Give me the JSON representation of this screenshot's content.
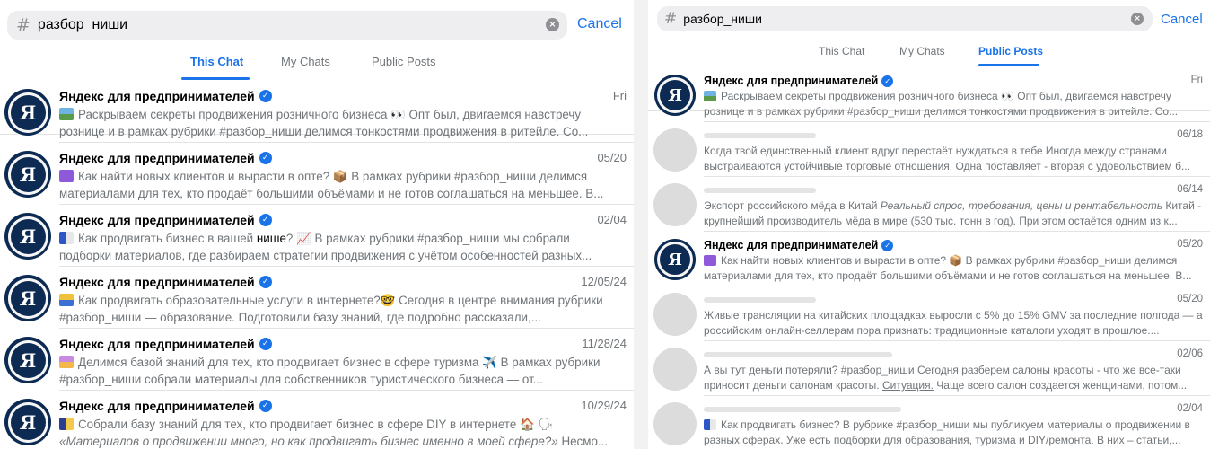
{
  "colors": {
    "accent": "#1a73e8",
    "secondary_text": "#707579",
    "search_bg": "#eeeef0",
    "avatar_navy": "#0c2a52",
    "placeholder": "#dcdcdc"
  },
  "left": {
    "search": {
      "hash": "#",
      "query": "разбор_ниши",
      "clear_icon": "×",
      "cancel": "Cancel"
    },
    "tabs": [
      {
        "label": "This Chat",
        "active": true
      },
      {
        "label": "My Chats",
        "active": false
      },
      {
        "label": "Public Posts",
        "active": false
      }
    ],
    "results": [
      {
        "avatar_letter": "Я",
        "channel": "Яндекс для предпринимателей",
        "date": "Fri",
        "emoji": "picture-icon",
        "text": "Раскрываем секреты продвижения розничного бизнеса 👀 Опт был, двигаемся навстречу рознице и в рамках рубрики #разбор_ниши делимся тонкостями продвижения в ритейле.   Со..."
      },
      {
        "avatar_letter": "Я",
        "channel": "Яндекс для предпринимателей",
        "date": "05/20",
        "emoji": "chart-icon",
        "text": "Как найти новых клиентов и вырасти в опте? 📦 В рамках рубрики #разбор_ниши делимся материалами для тех, кто продаёт большими объёмами и не готов соглашаться на меньшее. В..."
      },
      {
        "avatar_letter": "Я",
        "channel": "Яндекс для предпринимателей",
        "date": "02/04",
        "emoji": "flag-icon",
        "text_a": "Как продвигать бизнес в вашей ",
        "text_hl": "нише",
        "text_b": "? 📈 В рамках рубрики #разбор_ниши мы собрали подборки материалов, где разбираем стратегии продвижения с учётом особенностей разных..."
      },
      {
        "avatar_letter": "Я",
        "channel": "Яндекс для предпринимателей",
        "date": "12/05/24",
        "emoji": "book-icon",
        "text": "Как продвигать образовательные услуги в интернете?🤓 Сегодня в центре внимания рубрики #разбор_ниши — образование. Подготовили базу знаний, где подробно рассказали,..."
      },
      {
        "avatar_letter": "Я",
        "channel": "Яндекс для предпринимателей",
        "date": "11/28/24",
        "emoji": "photo-icon",
        "text": "Делимся базой знаний для тех, кто продвигает бизнес в сфере туризма ✈️ В рамках рубрики #разбор_ниши собрали материалы для собственников туристического бизнеса — от..."
      },
      {
        "avatar_letter": "Я",
        "channel": "Яндекс для предпринимателей",
        "date": "10/29/24",
        "emoji": "tools-icon",
        "text_a": "Собрали базу знаний для тех, кто продвигает бизнес в сфере DIY в интернете 🏠 🗣",
        "text_i": "«Материалов о продвижении много, но как продвигать бизнес именно в моей сфере?»",
        "text_b": " Несмо..."
      }
    ]
  },
  "right": {
    "search": {
      "hash": "#",
      "query": "разбор_ниши",
      "clear_icon": "×",
      "cancel": "Cancel"
    },
    "tabs": [
      {
        "label": "This Chat",
        "active": false
      },
      {
        "label": "My Chats",
        "active": false
      },
      {
        "label": "Public Posts",
        "active": true
      }
    ],
    "results": [
      {
        "kind": "channel",
        "avatar_letter": "Я",
        "channel": "Яндекс для предпринимателей",
        "date": "Fri",
        "emoji": "picture-icon",
        "text": "Раскрываем секреты продвижения розничного бизнеса 👀 Опт был, двигаемся навстречу рознице и в рамках рубрики #разбор_ниши делимся тонкостями продвижения в ритейле.   Со..."
      },
      {
        "kind": "hidden",
        "date": "06/18",
        "text": "Когда твой единственный клиент вдруг перестаёт нуждаться в тебе Иногда между странами выстраиваются устойчивые торговые отношения. Одна поставляет - вторая с удовольствием б..."
      },
      {
        "kind": "hidden",
        "date": "06/14",
        "text_a": "Экспорт российского мёда в Китай ",
        "text_i": "Реальный спрос, требования, цены и рентабельность",
        "text_b": " Китай - крупнейший производитель мёда в мире (530 тыс. тонн в год). При этом остаётся одним из к..."
      },
      {
        "kind": "channel",
        "avatar_letter": "Я",
        "channel": "Яндекс для предпринимателей",
        "date": "05/20",
        "emoji": "chart-icon",
        "text": "Как найти новых клиентов и вырасти в опте? 📦 В рамках рубрики #разбор_ниши делимся материалами для тех, кто продаёт большими объёмами и не готов соглашаться на меньшее. В..."
      },
      {
        "kind": "hidden",
        "date": "05/20",
        "text": "Живые трансляции на китайских площадках выросли с 5% до 15% GMV за последние полгода — а российским онлайн-селлерам пора признать: традиционные каталоги уходят в прошлое...."
      },
      {
        "kind": "hidden",
        "date": "02/06",
        "text_a": "А вы тут деньги потеряли? #разбор_ниши Сегодня разберем салоны красоты - что же все-таки приносит деньги салонам красоты. ",
        "text_u": "Ситуация.",
        "text_b": " Чаще всего салон создается женщинами, потом..."
      },
      {
        "kind": "hidden",
        "date": "02/04",
        "emoji": "flag-icon",
        "text": "Как продвигать бизнес? В рубрике #разбор_ниши мы публикуем материалы о продвижении в разных сферах. Уже есть подборки для образования, туризма и DIY/ремонта. В них – статьи,..."
      }
    ]
  }
}
